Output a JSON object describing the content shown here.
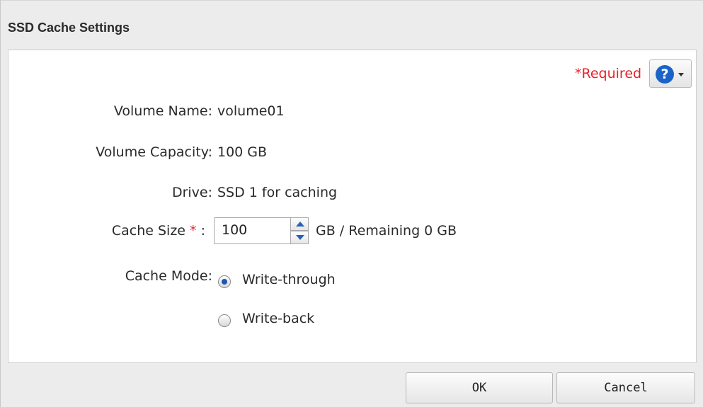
{
  "dialog": {
    "title": "SSD Cache Settings",
    "required_label": "*Required",
    "help_symbol": "?"
  },
  "form": {
    "volume_name": {
      "label": "Volume Name:",
      "value": "volume01"
    },
    "volume_capacity": {
      "label": "Volume Capacity:",
      "value": "100 GB"
    },
    "drive": {
      "label": "Drive:",
      "value": "SSD 1 for caching"
    },
    "cache_size": {
      "label": "Cache Size",
      "required_mark": "*",
      "colon": ":",
      "value": "100",
      "suffix": "GB / Remaining 0 GB"
    },
    "cache_mode": {
      "label": "Cache Mode:",
      "options": [
        {
          "label": "Write-through",
          "selected": true
        },
        {
          "label": "Write-back",
          "selected": false
        }
      ]
    }
  },
  "buttons": {
    "ok": "OK",
    "cancel": "Cancel"
  },
  "colors": {
    "required": "#e8202a",
    "accent": "#1b63c7"
  },
  "icons": {
    "help": "help-circle-icon",
    "dropdown": "caret-down-icon",
    "spin_up": "chevron-up-icon",
    "spin_down": "chevron-down-icon"
  }
}
